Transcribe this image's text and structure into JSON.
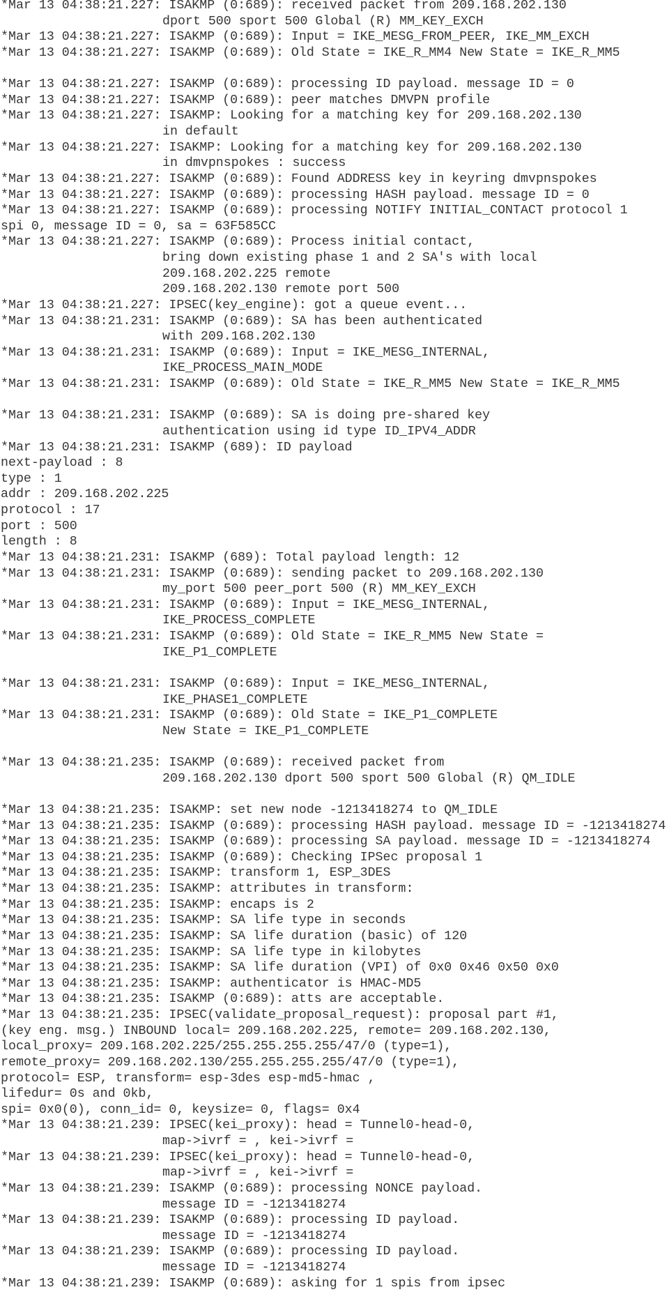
{
  "document": {
    "type": "debug-log",
    "lines": [
      {
        "kind": "entry",
        "text": "*Mar 13 04:38:21.227: ISAKMP (0:689): received packet from 209.168.202.130"
      },
      {
        "kind": "cont",
        "text": "dport 500 sport 500 Global (R) MM_KEY_EXCH"
      },
      {
        "kind": "entry",
        "text": "*Mar 13 04:38:21.227: ISAKMP (0:689): Input = IKE_MESG_FROM_PEER, IKE_MM_EXCH"
      },
      {
        "kind": "entry",
        "text": "*Mar 13 04:38:21.227: ISAKMP (0:689): Old State = IKE_R_MM4 New State = IKE_R_MM5"
      },
      {
        "kind": "blank",
        "text": ""
      },
      {
        "kind": "entry",
        "text": "*Mar 13 04:38:21.227: ISAKMP (0:689): processing ID payload. message ID = 0"
      },
      {
        "kind": "entry",
        "text": "*Mar 13 04:38:21.227: ISAKMP (0:689): peer matches DMVPN profile"
      },
      {
        "kind": "entry",
        "text": "*Mar 13 04:38:21.227: ISAKMP: Looking for a matching key for 209.168.202.130"
      },
      {
        "kind": "cont",
        "text": "in default"
      },
      {
        "kind": "entry",
        "text": "*Mar 13 04:38:21.227: ISAKMP: Looking for a matching key for 209.168.202.130"
      },
      {
        "kind": "cont",
        "text": "in dmvpnspokes : success"
      },
      {
        "kind": "entry",
        "text": "*Mar 13 04:38:21.227: ISAKMP (0:689): Found ADDRESS key in keyring dmvpnspokes"
      },
      {
        "kind": "entry",
        "text": "*Mar 13 04:38:21.227: ISAKMP (0:689): processing HASH payload. message ID = 0"
      },
      {
        "kind": "entry",
        "text": "*Mar 13 04:38:21.227: ISAKMP (0:689): processing NOTIFY INITIAL_CONTACT protocol 1"
      },
      {
        "kind": "entry",
        "text": "spi 0, message ID = 0, sa = 63F585CC"
      },
      {
        "kind": "entry",
        "text": "*Mar 13 04:38:21.227: ISAKMP (0:689): Process initial contact,"
      },
      {
        "kind": "cont",
        "text": "bring down existing phase 1 and 2 SA's with local"
      },
      {
        "kind": "cont",
        "text": "209.168.202.225 remote"
      },
      {
        "kind": "cont",
        "text": "209.168.202.130 remote port 500"
      },
      {
        "kind": "entry",
        "text": "*Mar 13 04:38:21.227: IPSEC(key_engine): got a queue event..."
      },
      {
        "kind": "entry",
        "text": "*Mar 13 04:38:21.231: ISAKMP (0:689): SA has been authenticated"
      },
      {
        "kind": "cont",
        "text": "with 209.168.202.130"
      },
      {
        "kind": "entry",
        "text": "*Mar 13 04:38:21.231: ISAKMP (0:689): Input = IKE_MESG_INTERNAL,"
      },
      {
        "kind": "cont",
        "text": "IKE_PROCESS_MAIN_MODE"
      },
      {
        "kind": "entry",
        "text": "*Mar 13 04:38:21.231: ISAKMP (0:689): Old State = IKE_R_MM5 New State = IKE_R_MM5"
      },
      {
        "kind": "blank",
        "text": ""
      },
      {
        "kind": "entry",
        "text": "*Mar 13 04:38:21.231: ISAKMP (0:689): SA is doing pre-shared key"
      },
      {
        "kind": "cont",
        "text": "authentication using id type ID_IPV4_ADDR"
      },
      {
        "kind": "entry",
        "text": "*Mar 13 04:38:21.231: ISAKMP (689): ID payload"
      },
      {
        "kind": "entry",
        "text": "next-payload : 8"
      },
      {
        "kind": "entry",
        "text": "type : 1"
      },
      {
        "kind": "entry",
        "text": "addr : 209.168.202.225"
      },
      {
        "kind": "entry",
        "text": "protocol : 17"
      },
      {
        "kind": "entry",
        "text": "port : 500"
      },
      {
        "kind": "entry",
        "text": "length : 8"
      },
      {
        "kind": "entry",
        "text": "*Mar 13 04:38:21.231: ISAKMP (689): Total payload length: 12"
      },
      {
        "kind": "entry",
        "text": "*Mar 13 04:38:21.231: ISAKMP (0:689): sending packet to 209.168.202.130"
      },
      {
        "kind": "cont",
        "text": "my_port 500 peer_port 500 (R) MM_KEY_EXCH"
      },
      {
        "kind": "entry",
        "text": "*Mar 13 04:38:21.231: ISAKMP (0:689): Input = IKE_MESG_INTERNAL,"
      },
      {
        "kind": "cont",
        "text": "IKE_PROCESS_COMPLETE"
      },
      {
        "kind": "entry",
        "text": "*Mar 13 04:38:21.231: ISAKMP (0:689): Old State = IKE_R_MM5 New State ="
      },
      {
        "kind": "cont",
        "text": "IKE_P1_COMPLETE"
      },
      {
        "kind": "blank",
        "text": ""
      },
      {
        "kind": "entry",
        "text": "*Mar 13 04:38:21.231: ISAKMP (0:689): Input = IKE_MESG_INTERNAL,"
      },
      {
        "kind": "cont",
        "text": "IKE_PHASE1_COMPLETE"
      },
      {
        "kind": "entry",
        "text": "*Mar 13 04:38:21.231: ISAKMP (0:689): Old State = IKE_P1_COMPLETE"
      },
      {
        "kind": "cont",
        "text": "New State = IKE_P1_COMPLETE"
      },
      {
        "kind": "blank",
        "text": ""
      },
      {
        "kind": "entry",
        "text": "*Mar 13 04:38:21.235: ISAKMP (0:689): received packet from"
      },
      {
        "kind": "cont",
        "text": "209.168.202.130 dport 500 sport 500 Global (R) QM_IDLE"
      },
      {
        "kind": "blank",
        "text": ""
      },
      {
        "kind": "entry",
        "text": "*Mar 13 04:38:21.235: ISAKMP: set new node -1213418274 to QM_IDLE"
      },
      {
        "kind": "entry",
        "text": "*Mar 13 04:38:21.235: ISAKMP (0:689): processing HASH payload. message ID = -1213418274"
      },
      {
        "kind": "entry",
        "text": "*Mar 13 04:38:21.235: ISAKMP (0:689): processing SA payload. message ID = -1213418274"
      },
      {
        "kind": "entry",
        "text": "*Mar 13 04:38:21.235: ISAKMP (0:689): Checking IPSec proposal 1"
      },
      {
        "kind": "entry",
        "text": "*Mar 13 04:38:21.235: ISAKMP: transform 1, ESP_3DES"
      },
      {
        "kind": "entry",
        "text": "*Mar 13 04:38:21.235: ISAKMP: attributes in transform:"
      },
      {
        "kind": "entry",
        "text": "*Mar 13 04:38:21.235: ISAKMP: encaps is 2"
      },
      {
        "kind": "entry",
        "text": "*Mar 13 04:38:21.235: ISAKMP: SA life type in seconds"
      },
      {
        "kind": "entry",
        "text": "*Mar 13 04:38:21.235: ISAKMP: SA life duration (basic) of 120"
      },
      {
        "kind": "entry",
        "text": "*Mar 13 04:38:21.235: ISAKMP: SA life type in kilobytes"
      },
      {
        "kind": "entry",
        "text": "*Mar 13 04:38:21.235: ISAKMP: SA life duration (VPI) of 0x0 0x46 0x50 0x0"
      },
      {
        "kind": "entry",
        "text": "*Mar 13 04:38:21.235: ISAKMP: authenticator is HMAC-MD5"
      },
      {
        "kind": "entry",
        "text": "*Mar 13 04:38:21.235: ISAKMP (0:689): atts are acceptable."
      },
      {
        "kind": "entry",
        "text": "*Mar 13 04:38:21.235: IPSEC(validate_proposal_request): proposal part #1,"
      },
      {
        "kind": "entry",
        "text": "(key eng. msg.) INBOUND local= 209.168.202.225, remote= 209.168.202.130,"
      },
      {
        "kind": "entry",
        "text": "local_proxy= 209.168.202.225/255.255.255.255/47/0 (type=1),"
      },
      {
        "kind": "entry",
        "text": "remote_proxy= 209.168.202.130/255.255.255.255/47/0 (type=1),"
      },
      {
        "kind": "entry",
        "text": "protocol= ESP, transform= esp-3des esp-md5-hmac ,"
      },
      {
        "kind": "entry",
        "text": "lifedur= 0s and 0kb,"
      },
      {
        "kind": "entry",
        "text": "spi= 0x0(0), conn_id= 0, keysize= 0, flags= 0x4"
      },
      {
        "kind": "entry",
        "text": "*Mar 13 04:38:21.239: IPSEC(kei_proxy): head = Tunnel0-head-0,"
      },
      {
        "kind": "cont",
        "text": "map->ivrf = , kei->ivrf ="
      },
      {
        "kind": "entry",
        "text": "*Mar 13 04:38:21.239: IPSEC(kei_proxy): head = Tunnel0-head-0,"
      },
      {
        "kind": "cont",
        "text": "map->ivrf = , kei->ivrf ="
      },
      {
        "kind": "entry",
        "text": "*Mar 13 04:38:21.239: ISAKMP (0:689): processing NONCE payload."
      },
      {
        "kind": "cont",
        "text": "message ID = -1213418274"
      },
      {
        "kind": "entry",
        "text": "*Mar 13 04:38:21.239: ISAKMP (0:689): processing ID payload."
      },
      {
        "kind": "cont",
        "text": "message ID = -1213418274"
      },
      {
        "kind": "entry",
        "text": "*Mar 13 04:38:21.239: ISAKMP (0:689): processing ID payload."
      },
      {
        "kind": "cont",
        "text": "message ID = -1213418274"
      },
      {
        "kind": "entry",
        "text": "*Mar 13 04:38:21.239: ISAKMP (0:689): asking for 1 spis from ipsec"
      }
    ]
  }
}
